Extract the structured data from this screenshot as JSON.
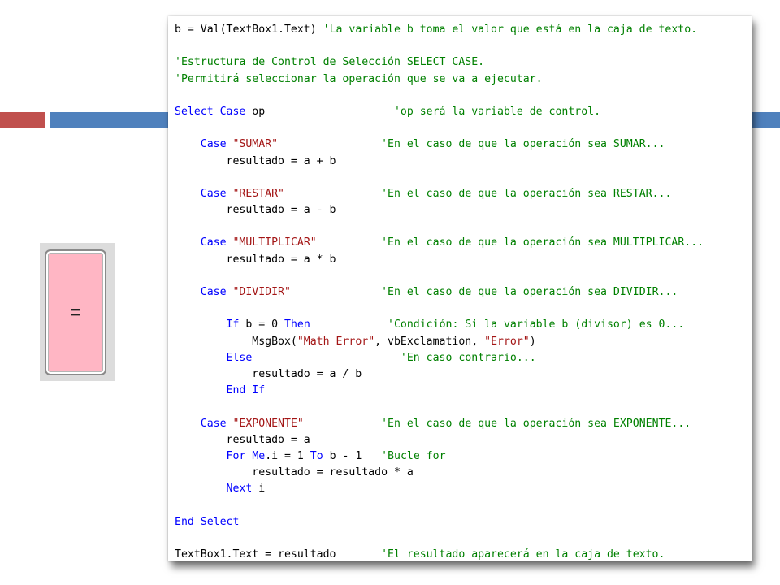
{
  "colors": {
    "keyword": "#0000ff",
    "string": "#a31515",
    "comment": "#008000",
    "button_fill": "#ffb6c4",
    "accent_red": "#c0504d",
    "accent_blue": "#4f81bd"
  },
  "equals_button": {
    "label": "="
  },
  "code_lines": [
    [
      {
        "t": "txt",
        "v": "b = Val(TextBox1.Text) "
      },
      {
        "t": "com",
        "v": "'La variable b toma el valor que está en la caja de texto."
      }
    ],
    [],
    [
      {
        "t": "com",
        "v": "'Estructura de Control de Selección SELECT CASE."
      }
    ],
    [
      {
        "t": "com",
        "v": "'Permitirá seleccionar la operación que se va a ejecutar."
      }
    ],
    [],
    [
      {
        "t": "kw",
        "v": "Select Case"
      },
      {
        "t": "txt",
        "v": " op                    "
      },
      {
        "t": "com",
        "v": "'op será la variable de control."
      }
    ],
    [],
    [
      {
        "t": "txt",
        "v": "    "
      },
      {
        "t": "kw",
        "v": "Case"
      },
      {
        "t": "txt",
        "v": " "
      },
      {
        "t": "str",
        "v": "\"SUMAR\""
      },
      {
        "t": "txt",
        "v": "                "
      },
      {
        "t": "com",
        "v": "'En el caso de que la operación sea SUMAR..."
      }
    ],
    [
      {
        "t": "txt",
        "v": "        resultado = a + b"
      }
    ],
    [],
    [
      {
        "t": "txt",
        "v": "    "
      },
      {
        "t": "kw",
        "v": "Case"
      },
      {
        "t": "txt",
        "v": " "
      },
      {
        "t": "str",
        "v": "\"RESTAR\""
      },
      {
        "t": "txt",
        "v": "               "
      },
      {
        "t": "com",
        "v": "'En el caso de que la operación sea RESTAR..."
      }
    ],
    [
      {
        "t": "txt",
        "v": "        resultado = a - b"
      }
    ],
    [],
    [
      {
        "t": "txt",
        "v": "    "
      },
      {
        "t": "kw",
        "v": "Case"
      },
      {
        "t": "txt",
        "v": " "
      },
      {
        "t": "str",
        "v": "\"MULTIPLICAR\""
      },
      {
        "t": "txt",
        "v": "          "
      },
      {
        "t": "com",
        "v": "'En el caso de que la operación sea MULTIPLICAR..."
      }
    ],
    [
      {
        "t": "txt",
        "v": "        resultado = a * b"
      }
    ],
    [],
    [
      {
        "t": "txt",
        "v": "    "
      },
      {
        "t": "kw",
        "v": "Case"
      },
      {
        "t": "txt",
        "v": " "
      },
      {
        "t": "str",
        "v": "\"DIVIDIR\""
      },
      {
        "t": "txt",
        "v": "              "
      },
      {
        "t": "com",
        "v": "'En el caso de que la operación sea DIVIDIR..."
      }
    ],
    [],
    [
      {
        "t": "txt",
        "v": "        "
      },
      {
        "t": "kw",
        "v": "If"
      },
      {
        "t": "txt",
        "v": " b = 0 "
      },
      {
        "t": "kw",
        "v": "Then"
      },
      {
        "t": "txt",
        "v": "            "
      },
      {
        "t": "com",
        "v": "'Condición: Si la variable b (divisor) es 0..."
      }
    ],
    [
      {
        "t": "txt",
        "v": "            MsgBox("
      },
      {
        "t": "str",
        "v": "\"Math Error\""
      },
      {
        "t": "txt",
        "v": ", vbExclamation, "
      },
      {
        "t": "str",
        "v": "\"Error\""
      },
      {
        "t": "txt",
        "v": ")"
      }
    ],
    [
      {
        "t": "txt",
        "v": "        "
      },
      {
        "t": "kw",
        "v": "Else"
      },
      {
        "t": "txt",
        "v": "                       "
      },
      {
        "t": "com",
        "v": "'En caso contrario..."
      }
    ],
    [
      {
        "t": "txt",
        "v": "            resultado = a / b"
      }
    ],
    [
      {
        "t": "txt",
        "v": "        "
      },
      {
        "t": "kw",
        "v": "End If"
      }
    ],
    [],
    [
      {
        "t": "txt",
        "v": "    "
      },
      {
        "t": "kw",
        "v": "Case"
      },
      {
        "t": "txt",
        "v": " "
      },
      {
        "t": "str",
        "v": "\"EXPONENTE\""
      },
      {
        "t": "txt",
        "v": "            "
      },
      {
        "t": "com",
        "v": "'En el caso de que la operación sea EXPONENTE..."
      }
    ],
    [
      {
        "t": "txt",
        "v": "        resultado = a"
      }
    ],
    [
      {
        "t": "txt",
        "v": "        "
      },
      {
        "t": "kw",
        "v": "For"
      },
      {
        "t": "txt",
        "v": " "
      },
      {
        "t": "kw",
        "v": "Me"
      },
      {
        "t": "txt",
        "v": ".i = 1 "
      },
      {
        "t": "kw",
        "v": "To"
      },
      {
        "t": "txt",
        "v": " b - 1   "
      },
      {
        "t": "com",
        "v": "'Bucle for"
      }
    ],
    [
      {
        "t": "txt",
        "v": "            resultado = resultado * a"
      }
    ],
    [
      {
        "t": "txt",
        "v": "        "
      },
      {
        "t": "kw",
        "v": "Next"
      },
      {
        "t": "txt",
        "v": " i"
      }
    ],
    [],
    [
      {
        "t": "kw",
        "v": "End Select"
      }
    ],
    [],
    [
      {
        "t": "txt",
        "v": "TextBox1.Text = resultado       "
      },
      {
        "t": "com",
        "v": "'El resultado aparecerá en la caja de texto."
      }
    ]
  ]
}
